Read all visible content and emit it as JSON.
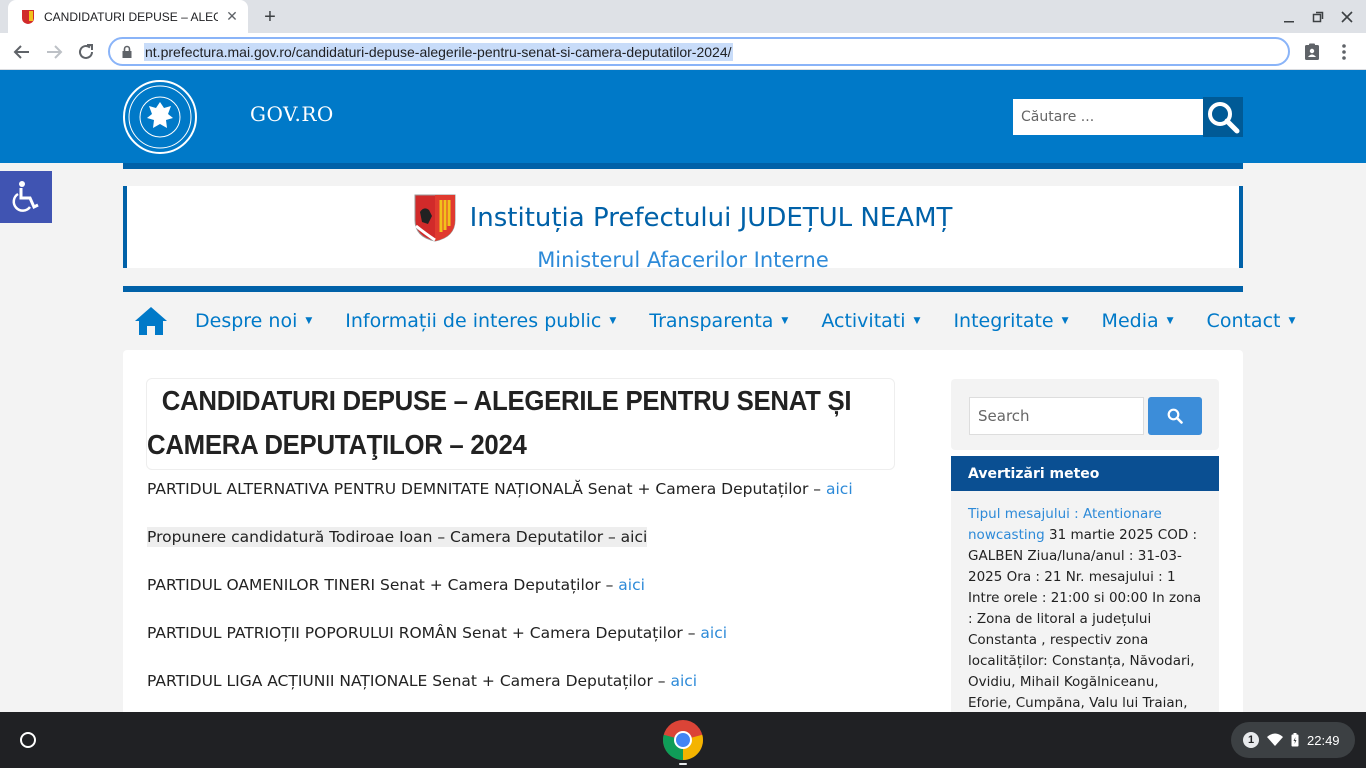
{
  "browser": {
    "tab_title": "CANDIDATURI DEPUSE – ALEGE",
    "url": "nt.prefectura.mai.gov.ro/candidaturi-depuse-alegerile-pentru-senat-si-camera-deputatilor-2024/"
  },
  "header": {
    "site_name": "GOV.RO",
    "search_placeholder": "Căutare ..."
  },
  "institution": {
    "name": "Instituția Prefectului JUDEȚUL NEAMȚ",
    "ministry": "Ministerul Afacerilor Interne"
  },
  "nav": {
    "items": [
      {
        "label": "Despre noi"
      },
      {
        "label": "Informații de interes public"
      },
      {
        "label": "Transparenta"
      },
      {
        "label": "Activitati"
      },
      {
        "label": "Integritate"
      },
      {
        "label": "Media"
      },
      {
        "label": "Contact"
      }
    ]
  },
  "post": {
    "title_line1": "CANDIDATURI DEPUSE – ALEGERILE PENTRU SENAT ȘI",
    "title_line2": "CAMERA DEPUTAŢILOR – 2024",
    "entries": [
      {
        "text": "PARTIDUL ALTERNATIVA PENTRU DEMNITATE NAȚIONALĂ Senat + Camera Deputaților – ",
        "link": "aici"
      },
      {
        "text": "Propunere candidatură Todiroae Ioan – Camera Deputatilor – aici",
        "link": ""
      },
      {
        "text": "PARTIDUL OAMENILOR TINERI Senat + Camera Deputaților – ",
        "link": "aici"
      },
      {
        "text": "PARTIDUL PATRIOȚII POPORULUI ROMÂN Senat + Camera Deputaților – ",
        "link": "aici"
      },
      {
        "text": "PARTIDUL LIGA ACȚIUNII NAȚIONALE Senat + Camera Deputaților – ",
        "link": "aici"
      }
    ]
  },
  "sidebar": {
    "search_placeholder": "Search",
    "meteo_title": "Avertizări meteo",
    "meteo_link": "Tipul mesajului : Atentionare nowcasting",
    "meteo_text": " 31 martie 2025 COD : GALBEN Ziua/luna/anul : 31-03-2025 Ora : 21 Nr. mesajului : 1 Intre orele : 21:00 si 00:00 In zona : Zona de litoral a județului Constanta , respectiv zona localităților: Constanța, Năvodari, Ovidiu, Mihail Kogălniceanu, Eforie, Cumpăna, Valu lui Traian,"
  },
  "shelf": {
    "notification_count": "1",
    "time": "22:49"
  },
  "colors": {
    "gov_blue": "#0079c8",
    "dark_blue": "#0061a8",
    "link_blue": "#2d8ad8",
    "accessibility": "#4054b2"
  }
}
